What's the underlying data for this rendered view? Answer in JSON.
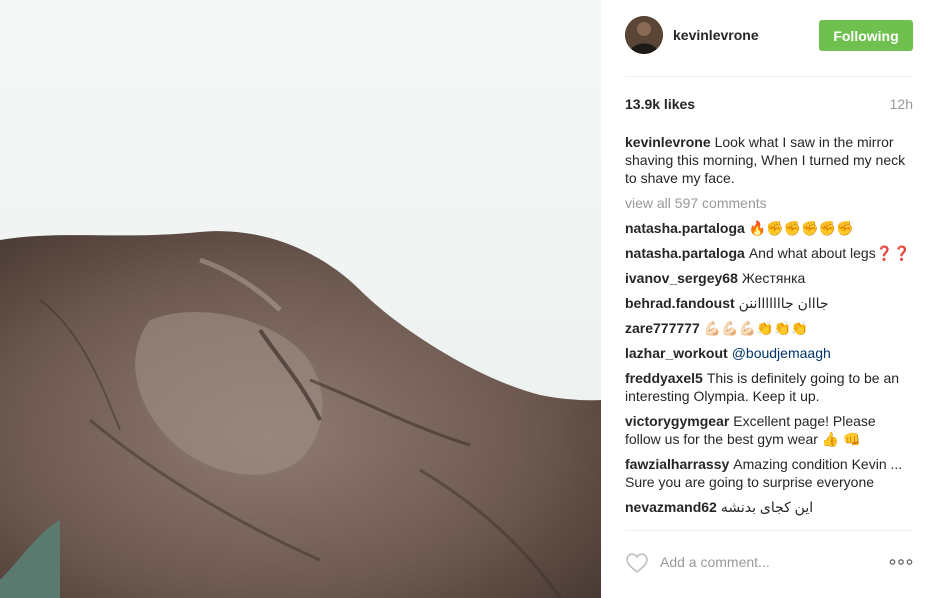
{
  "post": {
    "username": "kevinlevrone",
    "follow_label": "Following",
    "likes": "13.9k likes",
    "time": "12h",
    "caption": "Look what I saw in the mirror shaving this morning, When I turned my neck to shave my face.",
    "view_all": "view all 597 comments"
  },
  "comments": [
    {
      "user": "natasha.partaloga",
      "text": "🔥✊✊✊✊✊"
    },
    {
      "user": "natasha.partaloga",
      "text": "And what about legs❓❓"
    },
    {
      "user": "ivanov_sergey68",
      "text": "Жестянка"
    },
    {
      "user": "behrad.fandoust",
      "text": "جااان جاااااااننن"
    },
    {
      "user": "zare777777",
      "text": "💪🏻💪🏻💪🏻👏👏👏"
    },
    {
      "user": "lazhar_workout",
      "text": "@boudjemaagh"
    },
    {
      "user": "freddyaxel5",
      "text": "This is definitely going to be an interesting Olympia. Keep it up."
    },
    {
      "user": "victorygymgear",
      "text": "Excellent page! Please follow us for the best gym wear 👍 👊"
    },
    {
      "user": "fawzialharrassy",
      "text": "Amazing condition Kevin ... Sure you are going to surprise everyone"
    },
    {
      "user": "nevazmand62",
      "text": "این کجای بدنشه"
    }
  ],
  "add_comment": {
    "placeholder": "Add a comment..."
  },
  "icons": {
    "like": "heart-icon",
    "more": "more-options-icon"
  },
  "colors": {
    "follow": "#70c050",
    "mention": "#003569",
    "muted": "#999999"
  }
}
